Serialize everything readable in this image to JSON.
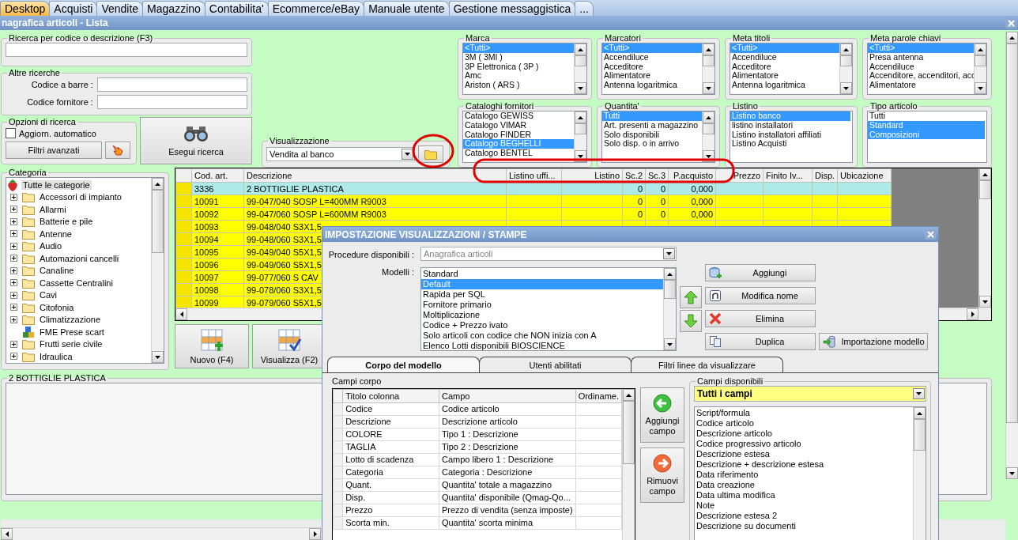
{
  "tabs": [
    {
      "label": "Desktop",
      "selected": true
    },
    {
      "label": "Acquisti",
      "selected": false
    },
    {
      "label": "Vendite",
      "selected": false
    },
    {
      "label": "Magazzino",
      "selected": false
    },
    {
      "label": "Contabilita'",
      "selected": false
    },
    {
      "label": "Ecommerce/eBay",
      "selected": false
    },
    {
      "label": "Manuale utente",
      "selected": false
    },
    {
      "label": "Gestione messaggistica",
      "selected": false
    },
    {
      "label": "...",
      "selected": false
    }
  ],
  "window": {
    "title": "nagrafica articoli  - Lista"
  },
  "search": {
    "title": "Ricerca per codice o descrizione (F3)"
  },
  "other_searches": {
    "title": "Altre ricerche",
    "fields": [
      {
        "label": "Codice a barre :"
      },
      {
        "label": "Codice fornitore :"
      }
    ]
  },
  "search_options": {
    "title": "Opzioni di ricerca",
    "auto_update": {
      "label": "Aggiorn. automatico",
      "checked": false
    },
    "advanced_filters_button": "Filtri avanzati"
  },
  "run_search_button": "Esegui ricerca",
  "view": {
    "title": "Visualizzazione",
    "value": "Vendita al banco"
  },
  "filters": [
    {
      "title": "Marca",
      "scrollable": true,
      "items": [
        {
          "label": "<Tutti>",
          "selected": true
        },
        {
          "label": "3M ( 3MI )",
          "selected": false
        },
        {
          "label": "3P Elettronica ( 3P )",
          "selected": false
        },
        {
          "label": "Amc",
          "selected": false
        },
        {
          "label": "Ariston ( ARS )",
          "selected": false
        }
      ]
    },
    {
      "title": "Marcatori",
      "scrollable": true,
      "items": [
        {
          "label": "<Tutti>",
          "selected": true
        },
        {
          "label": "Accendiluce",
          "selected": false
        },
        {
          "label": "Acceditore",
          "selected": false
        },
        {
          "label": "Alimentatore",
          "selected": false
        },
        {
          "label": "Antenna logaritmica",
          "selected": false
        }
      ]
    },
    {
      "title": "Meta titoli",
      "scrollable": true,
      "items": [
        {
          "label": "<Tutti>",
          "selected": true
        },
        {
          "label": "Accendiluce",
          "selected": false
        },
        {
          "label": "Acceditore",
          "selected": false
        },
        {
          "label": "Alimentatore",
          "selected": false
        },
        {
          "label": "Antenna logaritmica",
          "selected": false
        }
      ]
    },
    {
      "title": "Meta parole chiavi",
      "scrollable": true,
      "items": [
        {
          "label": "<Tutti>",
          "selected": true
        },
        {
          "label": "Presa antenna",
          "selected": false
        },
        {
          "label": "Accendiluce",
          "selected": false
        },
        {
          "label": "Accenditore, accenditori, acc",
          "selected": false
        },
        {
          "label": "Alimentatore",
          "selected": false
        }
      ]
    },
    {
      "title": "Cataloghi fornitori",
      "scrollable": true,
      "items": [
        {
          "label": "Catalogo GEWISS",
          "selected": false
        },
        {
          "label": "Catalogo VIMAR",
          "selected": false
        },
        {
          "label": "Catalogo FINDER",
          "selected": false
        },
        {
          "label": "Catalogo BEGHELLI",
          "selected": true
        },
        {
          "label": "Catalogo BENTEL",
          "selected": false
        }
      ]
    },
    {
      "title": "Quantita'",
      "scrollable": true,
      "items": [
        {
          "label": "Tutti",
          "selected": true
        },
        {
          "label": "Art. presenti a magazzino",
          "selected": false
        },
        {
          "label": "Solo disponibili",
          "selected": false
        },
        {
          "label": "Solo disp. o in arrivo",
          "selected": false
        }
      ]
    },
    {
      "title": "Listino",
      "scrollable": false,
      "items": [
        {
          "label": "Listino banco",
          "selected": true
        },
        {
          "label": "listino installatori",
          "selected": false
        },
        {
          "label": "Listino installatori affiliati",
          "selected": false
        },
        {
          "label": "Listino Acquisti",
          "selected": false
        }
      ]
    },
    {
      "title": "Tipo articolo",
      "scrollable": false,
      "items": [
        {
          "label": "Tutti",
          "selected": false
        },
        {
          "label": "Standard",
          "selected": true
        },
        {
          "label": "Composizioni",
          "selected": true
        }
      ]
    }
  ],
  "category": {
    "title": "Categoria",
    "tree": [
      {
        "label": "Tutte le categorie",
        "kind": "root",
        "selected": true,
        "children": [
          {
            "label": "Accessori di impianto",
            "kind": "folder",
            "selected": false
          },
          {
            "label": "Allarmi",
            "kind": "folder",
            "selected": false
          },
          {
            "label": "Batterie e pile",
            "kind": "folder",
            "selected": false
          },
          {
            "label": "Antenne",
            "kind": "folder",
            "selected": false
          },
          {
            "label": "Audio",
            "kind": "folder",
            "selected": false
          },
          {
            "label": "Automazioni cancelli",
            "kind": "folder",
            "selected": false
          },
          {
            "label": "Canaline",
            "kind": "folder",
            "selected": false
          },
          {
            "label": "Cassette Centralini",
            "kind": "folder",
            "selected": false
          },
          {
            "label": "Cavi",
            "kind": "folder",
            "selected": false
          },
          {
            "label": "Citofonia",
            "kind": "folder",
            "selected": false
          },
          {
            "label": "Climatizzazione",
            "kind": "folder",
            "selected": false
          },
          {
            "label": "FME Prese scart",
            "kind": "group",
            "selected": false
          },
          {
            "label": "Frutti serie civile",
            "kind": "folder",
            "selected": false
          },
          {
            "label": "Idraulica",
            "kind": "folder",
            "selected": false
          }
        ]
      }
    ]
  },
  "articles": {
    "columns": [
      "Cod. art.",
      "Descrizione",
      "Listino uffi...",
      "Listino",
      "Sc.2",
      "Sc.3",
      "P.acquisto",
      "Prezzo",
      "Finito Iv...",
      "Disp.",
      "Ubicazione"
    ],
    "rows": [
      {
        "selected": true,
        "code": "3336",
        "description": "2 BOTTIGLIE PLASTICA",
        "sc2": "0",
        "sc3": "0",
        "purchase_price": "0,000"
      },
      {
        "selected": false,
        "code": "10091",
        "description": "99-047/040 SOSP L=400MM R9003",
        "sc2": "0",
        "sc3": "0",
        "purchase_price": "0,000"
      },
      {
        "selected": false,
        "code": "10092",
        "description": "99-047/060 SOSP L=600MM R9003",
        "sc2": "0",
        "sc3": "0",
        "purchase_price": "0,000"
      },
      {
        "selected": false,
        "code": "10093",
        "description": "99-048/040 S3X1,5"
      },
      {
        "selected": false,
        "code": "10094",
        "description": "99-048/060 S3X1,5"
      },
      {
        "selected": false,
        "code": "10095",
        "description": "99-049/040 S5X1,5"
      },
      {
        "selected": false,
        "code": "10096",
        "description": "99-049/060 S5X1,5"
      },
      {
        "selected": false,
        "code": "10097",
        "description": "99-077/060 S CAV"
      },
      {
        "selected": false,
        "code": "10098",
        "description": "99-078/060 S3X1,5"
      },
      {
        "selected": false,
        "code": "10099",
        "description": "99-079/060 S5X1,5"
      }
    ]
  },
  "action_buttons": [
    {
      "kind": "new",
      "label": "Nuovo (F4)"
    },
    {
      "kind": "view",
      "label": "Visualizza (F2)"
    }
  ],
  "description_panel": {
    "title": "2 BOTTIGLIE PLASTICA"
  },
  "dialog": {
    "title": "IMPOSTAZIONE VISUALIZZAZIONI / STAMPE",
    "procedure": {
      "label": "Procedure disponibili :",
      "value": "Anagrafica articoli",
      "disabled": true
    },
    "models": {
      "label": "Modelli :",
      "items": [
        {
          "label": "Standard",
          "selected": false
        },
        {
          "label": "Default",
          "selected": true
        },
        {
          "label": "Rapida per SQL",
          "selected": false
        },
        {
          "label": "Fornitore primario",
          "selected": false
        },
        {
          "label": "Moltiplicazione",
          "selected": false
        },
        {
          "label": "Codice + Prezzo ivato",
          "selected": false
        },
        {
          "label": "Solo articoli con codice che NON inizia con A",
          "selected": false
        },
        {
          "label": "Elenco Lotti disponibili BIOSCIENCE",
          "selected": false
        }
      ]
    },
    "buttons": [
      {
        "kind": "add",
        "label": "Aggiungi"
      },
      {
        "kind": "rename",
        "label": "Modifica nome"
      },
      {
        "kind": "delete",
        "label": "Elimina"
      },
      {
        "kind": "duplicate",
        "label": "Duplica"
      }
    ],
    "import_button": "Importazione modello",
    "tabs": [
      {
        "label": "Corpo del modello",
        "selected": true
      },
      {
        "label": "Utenti abilitati",
        "selected": false
      },
      {
        "label": "Filtri linee da visualizzare",
        "selected": false
      }
    ],
    "body_fields": {
      "title": "Campi corpo",
      "columns": [
        "Titolo colonna",
        "Campo",
        "Ordiname."
      ],
      "rows": [
        {
          "title": "Codice",
          "field": "Codice articolo"
        },
        {
          "title": "Descrizione",
          "field": "Descrizione articolo"
        },
        {
          "title": "COLORE",
          "field": "Tipo 1 : Descrizione"
        },
        {
          "title": "TAGLIA",
          "field": "Tipo 2 : Descrizione"
        },
        {
          "title": "Lotto di scadenza",
          "field": "Campo libero 1 : Descrizione"
        },
        {
          "title": "Categoria",
          "field": "Categoria : Descrizione"
        },
        {
          "title": "Quant.",
          "field": "Quantita' totale a magazzino"
        },
        {
          "title": "Disp.",
          "field": "Quantita' disponibile (Qmag-Qo..."
        },
        {
          "title": "Prezzo",
          "field": "Prezzo di vendita (senza imposte)"
        },
        {
          "title": "Scorta min.",
          "field": "Quantita' scorta minima"
        }
      ]
    },
    "add_field_button": "Aggiungi campo",
    "remove_field_button": "Rimuovi campo",
    "available_fields": {
      "title": "Campi disponibili",
      "filter": "Tutti i campi",
      "items": [
        "Script/formula",
        "Codice articolo",
        "Descrizione articolo",
        "Codice progressivo articolo",
        "Descrizione estesa",
        "Descrizione + descrizione estesa",
        "Data riferimento",
        "Data creazione",
        "Data ultima modifica",
        "Note",
        "Descrizione estesa 2",
        "Descrizione su documenti"
      ]
    }
  }
}
